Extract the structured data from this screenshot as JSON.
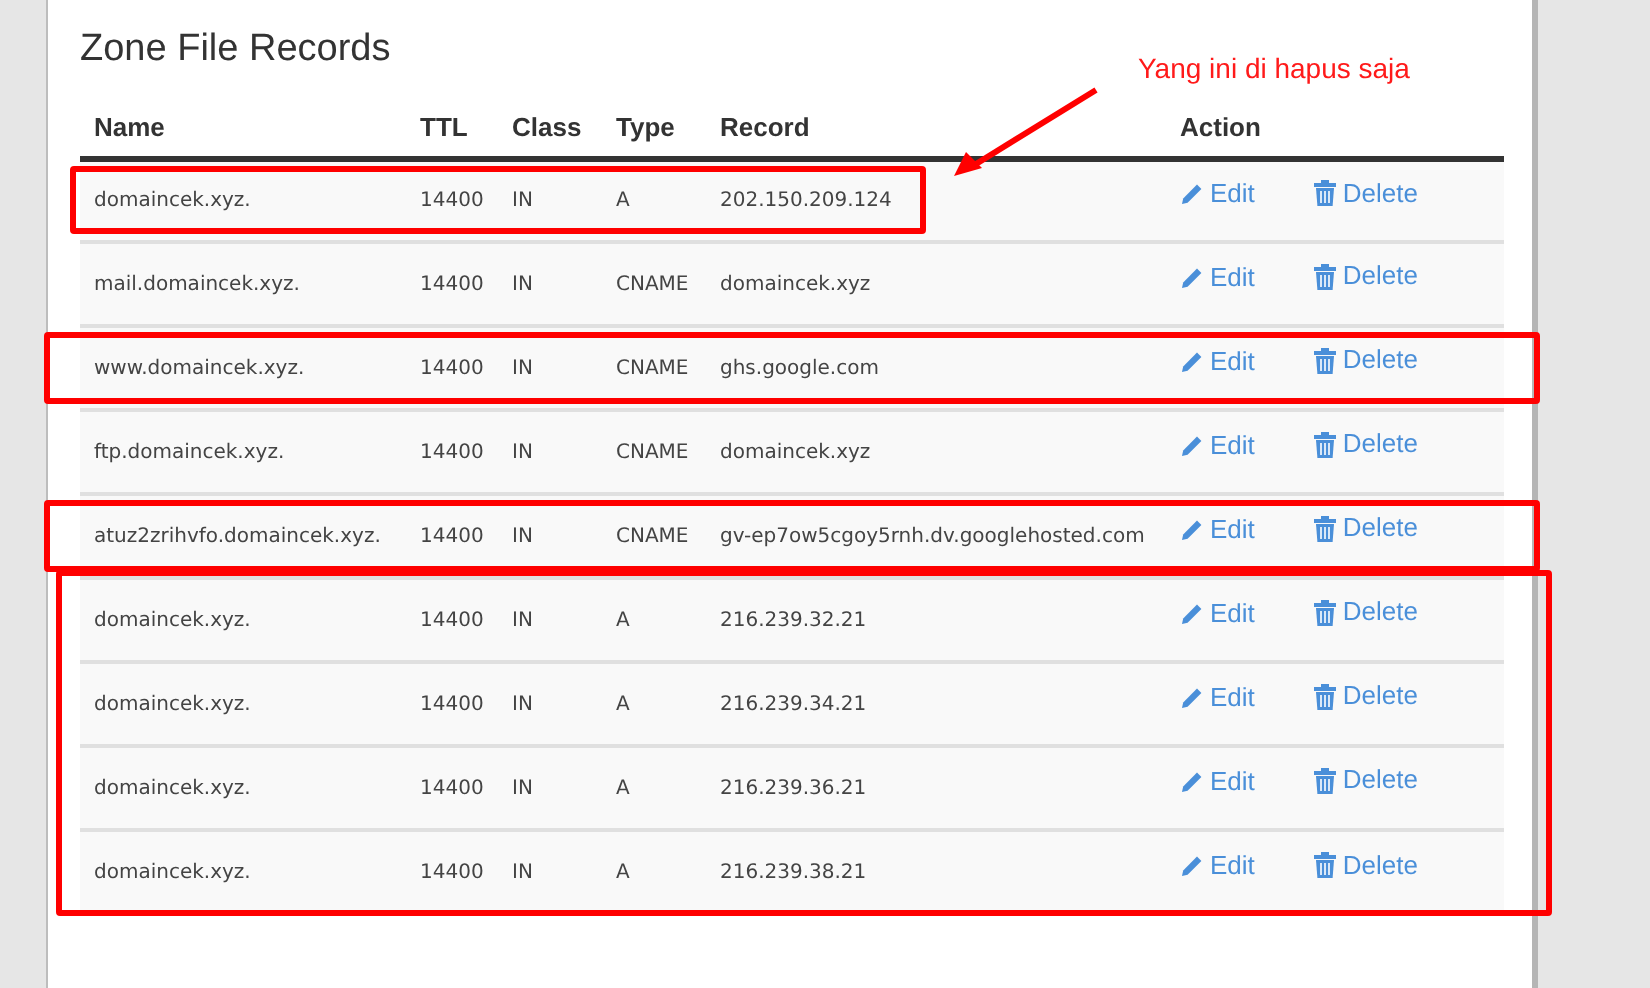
{
  "title": "Zone File Records",
  "columns": [
    "Name",
    "TTL",
    "Class",
    "Type",
    "Record",
    "Action"
  ],
  "row_groups": [
    {
      "framed": true,
      "narrow": true,
      "rows": [
        {
          "name": "domaincek.xyz.",
          "ttl": "14400",
          "class": "IN",
          "type": "A",
          "record": "202.150.209.124",
          "edit": "Edit",
          "delete": "Delete"
        }
      ]
    },
    {
      "framed": false,
      "rows": [
        {
          "name": "mail.domaincek.xyz.",
          "ttl": "14400",
          "class": "IN",
          "type": "CNAME",
          "record": "domaincek.xyz",
          "edit": "Edit",
          "delete": "Delete"
        }
      ]
    },
    {
      "framed": true,
      "narrow": false,
      "rows": [
        {
          "name": "www.domaincek.xyz.",
          "ttl": "14400",
          "class": "IN",
          "type": "CNAME",
          "record": "ghs.google.com",
          "edit": "Edit",
          "delete": "Delete"
        }
      ]
    },
    {
      "framed": false,
      "rows": [
        {
          "name": "ftp.domaincek.xyz.",
          "ttl": "14400",
          "class": "IN",
          "type": "CNAME",
          "record": "domaincek.xyz",
          "edit": "Edit",
          "delete": "Delete"
        }
      ]
    },
    {
      "framed": true,
      "narrow": false,
      "rows": [
        {
          "name": "atuz2zrihvfo.domaincek.xyz.",
          "ttl": "14400",
          "class": "IN",
          "type": "CNAME",
          "record": "gv-ep7ow5cgoy5rnh.dv.googlehosted.com",
          "edit": "Edit",
          "delete": "Delete"
        }
      ]
    },
    {
      "framed": true,
      "narrow": false,
      "rows": [
        {
          "name": "domaincek.xyz.",
          "ttl": "14400",
          "class": "IN",
          "type": "A",
          "record": "216.239.32.21",
          "edit": "Edit",
          "delete": "Delete"
        },
        {
          "name": "domaincek.xyz.",
          "ttl": "14400",
          "class": "IN",
          "type": "A",
          "record": "216.239.34.21",
          "edit": "Edit",
          "delete": "Delete"
        },
        {
          "name": "domaincek.xyz.",
          "ttl": "14400",
          "class": "IN",
          "type": "A",
          "record": "216.239.36.21",
          "edit": "Edit",
          "delete": "Delete"
        },
        {
          "name": "domaincek.xyz.",
          "ttl": "14400",
          "class": "IN",
          "type": "A",
          "record": "216.239.38.21",
          "edit": "Edit",
          "delete": "Delete"
        }
      ]
    }
  ],
  "annotation": {
    "note": "Yang ini di hapus saja"
  }
}
